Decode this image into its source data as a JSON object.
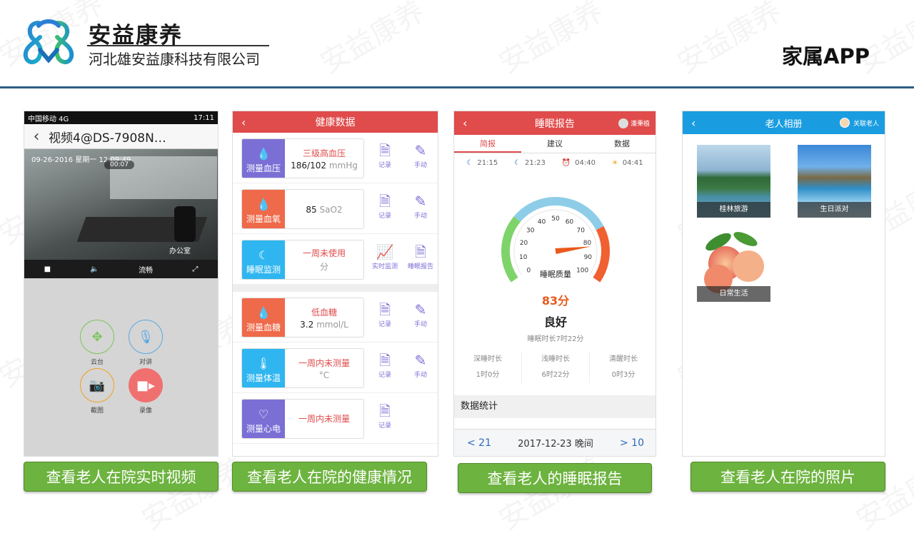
{
  "header": {
    "brand_name": "安益康养",
    "company": "河北雄安益康科技有限公司",
    "page_title": "家属APP"
  },
  "watermark": "安益康养",
  "colors": {
    "divider": "#2d5d82",
    "caption_green": "#6db33f",
    "red": "#e04b4b",
    "blue": "#1a9de0"
  },
  "phone1": {
    "status_left": "中国移动 4G",
    "status_right": "17:11",
    "title": "视频4@DS-7908N…",
    "timestamp": "09-26-2016 星期一 12:09:49",
    "timer": "00:07",
    "room_label": "办公室",
    "bar_quality": "流畅",
    "controls": [
      {
        "label": "云台",
        "icon": "ptz-icon"
      },
      {
        "label": "对讲",
        "icon": "microphone-icon"
      },
      {
        "label": "截图",
        "icon": "camera-icon"
      },
      {
        "label": "录像",
        "icon": "video-record-icon"
      }
    ]
  },
  "phone2": {
    "title": "健康数据",
    "rows": [
      {
        "label": "测量血压",
        "title": "三级高血压",
        "value": "186/102",
        "unit": "mmHg",
        "act1": "记录",
        "act2": "手动",
        "color": "#7b6fd6"
      },
      {
        "label": "测量血氧",
        "title": "",
        "value": "85",
        "unit": "SaO2",
        "act1": "记录",
        "act2": "手动",
        "color": "#ef6a4a"
      },
      {
        "label": "睡眠监测",
        "title": "一周未使用",
        "value": "",
        "unit": "分",
        "act1": "实时监测",
        "act2": "睡眠报告",
        "color": "#2fb6f0"
      },
      {
        "label": "测量血糖",
        "title": "低血糖",
        "value": "3.2",
        "unit": "mmol/L",
        "act1": "记录",
        "act2": "手动",
        "color": "#ef6a4a"
      },
      {
        "label": "测量体温",
        "title": "一周内未测量",
        "value": "",
        "unit": "°C",
        "act1": "记录",
        "act2": "手动",
        "color": "#2fb6f0"
      },
      {
        "label": "测量心电",
        "title": "一周内未测量",
        "value": "",
        "unit": "",
        "act1": "记录",
        "act2": "",
        "color": "#7b6fd6"
      }
    ]
  },
  "phone3": {
    "title": "睡眠报告",
    "user": "潘秉植",
    "tabs": [
      "简报",
      "建议",
      "数据"
    ],
    "times": [
      "21:15",
      "21:23",
      "04:40",
      "04:41"
    ],
    "gauge_ticks": [
      "0",
      "10",
      "20",
      "30",
      "40",
      "50",
      "60",
      "70",
      "80",
      "90",
      "100"
    ],
    "gauge_label": "睡眠质量",
    "score": "83分",
    "score_value": 83,
    "quality": "良好",
    "duration": "睡眠时长7时22分",
    "stats": [
      {
        "name": "深睡时长",
        "value": "1时0分"
      },
      {
        "name": "浅睡时长",
        "value": "6时22分"
      },
      {
        "name": "清醒时长",
        "value": "0时3分"
      }
    ],
    "stats_title": "数据统计",
    "prev": "< 21",
    "date": "2017-12-23 晚间",
    "next": "> 10"
  },
  "phone4": {
    "title": "老人相册",
    "link": "关联老人",
    "albums": [
      "桂林旅游",
      "生日派对",
      "日常生活"
    ]
  },
  "captions": [
    "查看老人在院实时视频",
    "查看老人在院的健康情况",
    "查看老人的睡眠报告",
    "查看老人在院的照片"
  ]
}
